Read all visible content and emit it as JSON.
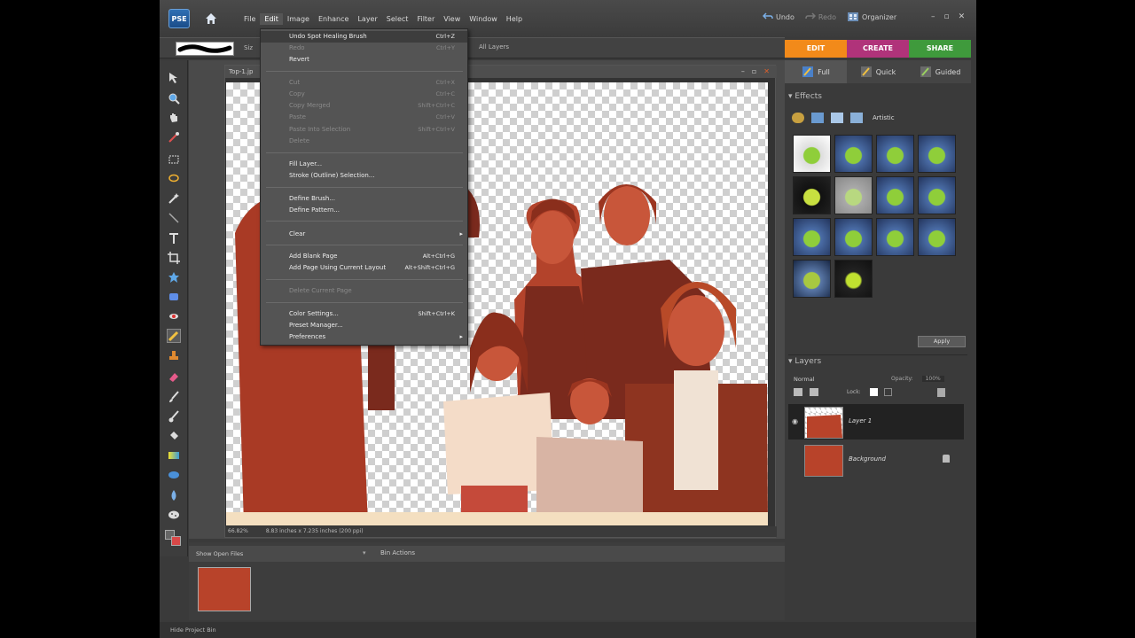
{
  "app": {
    "logo": "PSE"
  },
  "menubar": [
    "File",
    "Edit",
    "Image",
    "Enhance",
    "Layer",
    "Select",
    "Filter",
    "View",
    "Window",
    "Help"
  ],
  "topright": {
    "undo": "Undo",
    "redo": "Redo",
    "organizer": "Organizer"
  },
  "optionsbar": {
    "size_label": "Siz",
    "all_layers": "All Layers"
  },
  "document": {
    "title": "Top-1.jp",
    "zoom": "66.82%",
    "info": "8.83 inches x 7.235 inches (200 ppi)"
  },
  "edit_menu": {
    "undo": {
      "label": "Undo Spot Healing Brush",
      "shortcut": "Ctrl+Z"
    },
    "redo": {
      "label": "Redo",
      "shortcut": "Ctrl+Y"
    },
    "revert": {
      "label": "Revert"
    },
    "cut": {
      "label": "Cut",
      "shortcut": "Ctrl+X"
    },
    "copy": {
      "label": "Copy",
      "shortcut": "Ctrl+C"
    },
    "copy_merged": {
      "label": "Copy Merged",
      "shortcut": "Shift+Ctrl+C"
    },
    "paste": {
      "label": "Paste",
      "shortcut": "Ctrl+V"
    },
    "paste_into": {
      "label": "Paste Into Selection",
      "shortcut": "Shift+Ctrl+V"
    },
    "delete": {
      "label": "Delete"
    },
    "fill_layer": {
      "label": "Fill Layer..."
    },
    "stroke": {
      "label": "Stroke (Outline) Selection..."
    },
    "define_brush": {
      "label": "Define Brush..."
    },
    "define_pattern": {
      "label": "Define Pattern..."
    },
    "clear": {
      "label": "Clear"
    },
    "add_blank_page": {
      "label": "Add Blank Page",
      "shortcut": "Alt+Ctrl+G"
    },
    "add_page_layout": {
      "label": "Add Page Using Current Layout",
      "shortcut": "Alt+Shift+Ctrl+G"
    },
    "delete_page": {
      "label": "Delete Current Page"
    },
    "color_settings": {
      "label": "Color Settings...",
      "shortcut": "Shift+Ctrl+K"
    },
    "preset_manager": {
      "label": "Preset Manager..."
    },
    "preferences": {
      "label": "Preferences"
    }
  },
  "modetabs": {
    "edit": "EDIT",
    "create": "CREATE",
    "share": "SHARE"
  },
  "subtabs": {
    "full": "Full",
    "quick": "Quick",
    "guided": "Guided"
  },
  "effects": {
    "header": "Effects",
    "category": "Artistic",
    "apply": "Apply",
    "thumb_count": 14
  },
  "layers": {
    "header": "Layers",
    "blend_mode": "Normal",
    "opacity_label": "Opacity:",
    "opacity_value": "100%",
    "lock_label": "Lock:",
    "items": [
      {
        "name": "Layer 1"
      },
      {
        "name": "Background"
      }
    ]
  },
  "projectbin": {
    "show": "Show Open Files",
    "actions": "Bin Actions"
  },
  "bottombar": {
    "hide_bin": "Hide Project Bin"
  },
  "colors": {
    "edit_tab": "#f28a1a",
    "create_tab": "#b0337a",
    "share_tab": "#3f9a3c",
    "photo_red": "#b8432a"
  }
}
